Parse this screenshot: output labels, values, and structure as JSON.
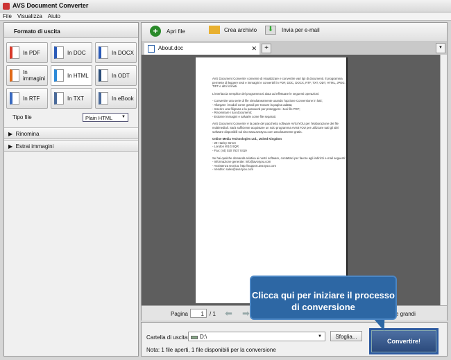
{
  "window": {
    "title": "AVS Document Converter"
  },
  "menu": [
    "File",
    "Visualizza",
    "Aiuto"
  ],
  "left": {
    "header": "Formato di uscita",
    "formats": [
      {
        "label": "In PDF",
        "color": "#d83a2a"
      },
      {
        "label": "In DOC",
        "color": "#2b5bb8"
      },
      {
        "label": "In DOCX",
        "color": "#2b5bb8"
      },
      {
        "label": "In immagini",
        "color": "#e06a1a"
      },
      {
        "label": "In HTML",
        "color": "#2d8ad8",
        "selected": true
      },
      {
        "label": "In ODT",
        "color": "#2d4f7a"
      },
      {
        "label": "In RTF",
        "color": "#3a6ac0"
      },
      {
        "label": "In TXT",
        "color": "#4a6a9a"
      },
      {
        "label": "In eBook",
        "color": "#4a6a9a"
      }
    ],
    "file_type_label": "Tipo file",
    "file_type_value": "Plain HTML",
    "sections": [
      "Rinomina",
      "Estrai immagini"
    ]
  },
  "toolbar": {
    "open": "Apri file",
    "archive": "Crea archivio",
    "email": "Invia per e-mail"
  },
  "tab": {
    "name": "About.doc"
  },
  "document": {
    "paragraphs": [
      "AVS Document Converter consente di visualizzare e convertire vari tipi di documenti. Il programma permette di leggere testi e immagini e convertirli in PDF, DOC, DOCX, RTF, TXT, ODT, HTML, JPEG, TIFF e altri formati.",
      "L'interfaccia semplice del programma ti aiuta ad effettuare le seguenti operazioni:",
      "- Convertire una serie di file simultaneamente usando l'opzione Conversione in lotti;\n- Allargare i moduli come grandi per trovare la pagina adatta;\n- Inserire una filigrana e la password per proteggere i tuoi file PDF;\n- Rinominare i tuoi documenti;\n- Estrarre immagini e salvarle come file separati.",
      "AVS Document Converter è la parte del pacchetto software AVS4YOU per l'elaborazione dei file multimediali. Sarà sufficiente acquistare un solo programma AVS4YOU per utilizzare tutti gli altri software disponibili sul sito www.avs4you.com assolutamente gratis."
    ],
    "company": "Online Media Technologies Ltd., United Kingdom",
    "address": "- 29 Harley Street\n- London W1G 9QR\n- Fax: (44) 020 7637 0419",
    "contact": "Se hai qualche domanda relativa ai nostri software, contattaci per favore agli indirizzi e-mail seguenti:\n- Informazione generale: info@avs4you.com\n- Assistenza tecnica: http://support.avs4you.com\n- Vendite: sales@avs4you.com"
  },
  "nav": {
    "page_label": "Pagina",
    "page_value": "1",
    "page_total": "/ 1",
    "zoom_text": "e grandi"
  },
  "bottom": {
    "folder_label": "Cartella di uscita:",
    "folder_value": "D:\\",
    "browse": "Sfoglia...",
    "note": "Nota: 1 file aperti, 1 file disponibili per la conversione",
    "convert": "Convertire!"
  },
  "callout": {
    "text": "Clicca qui per iniziare il processo di conversione"
  }
}
